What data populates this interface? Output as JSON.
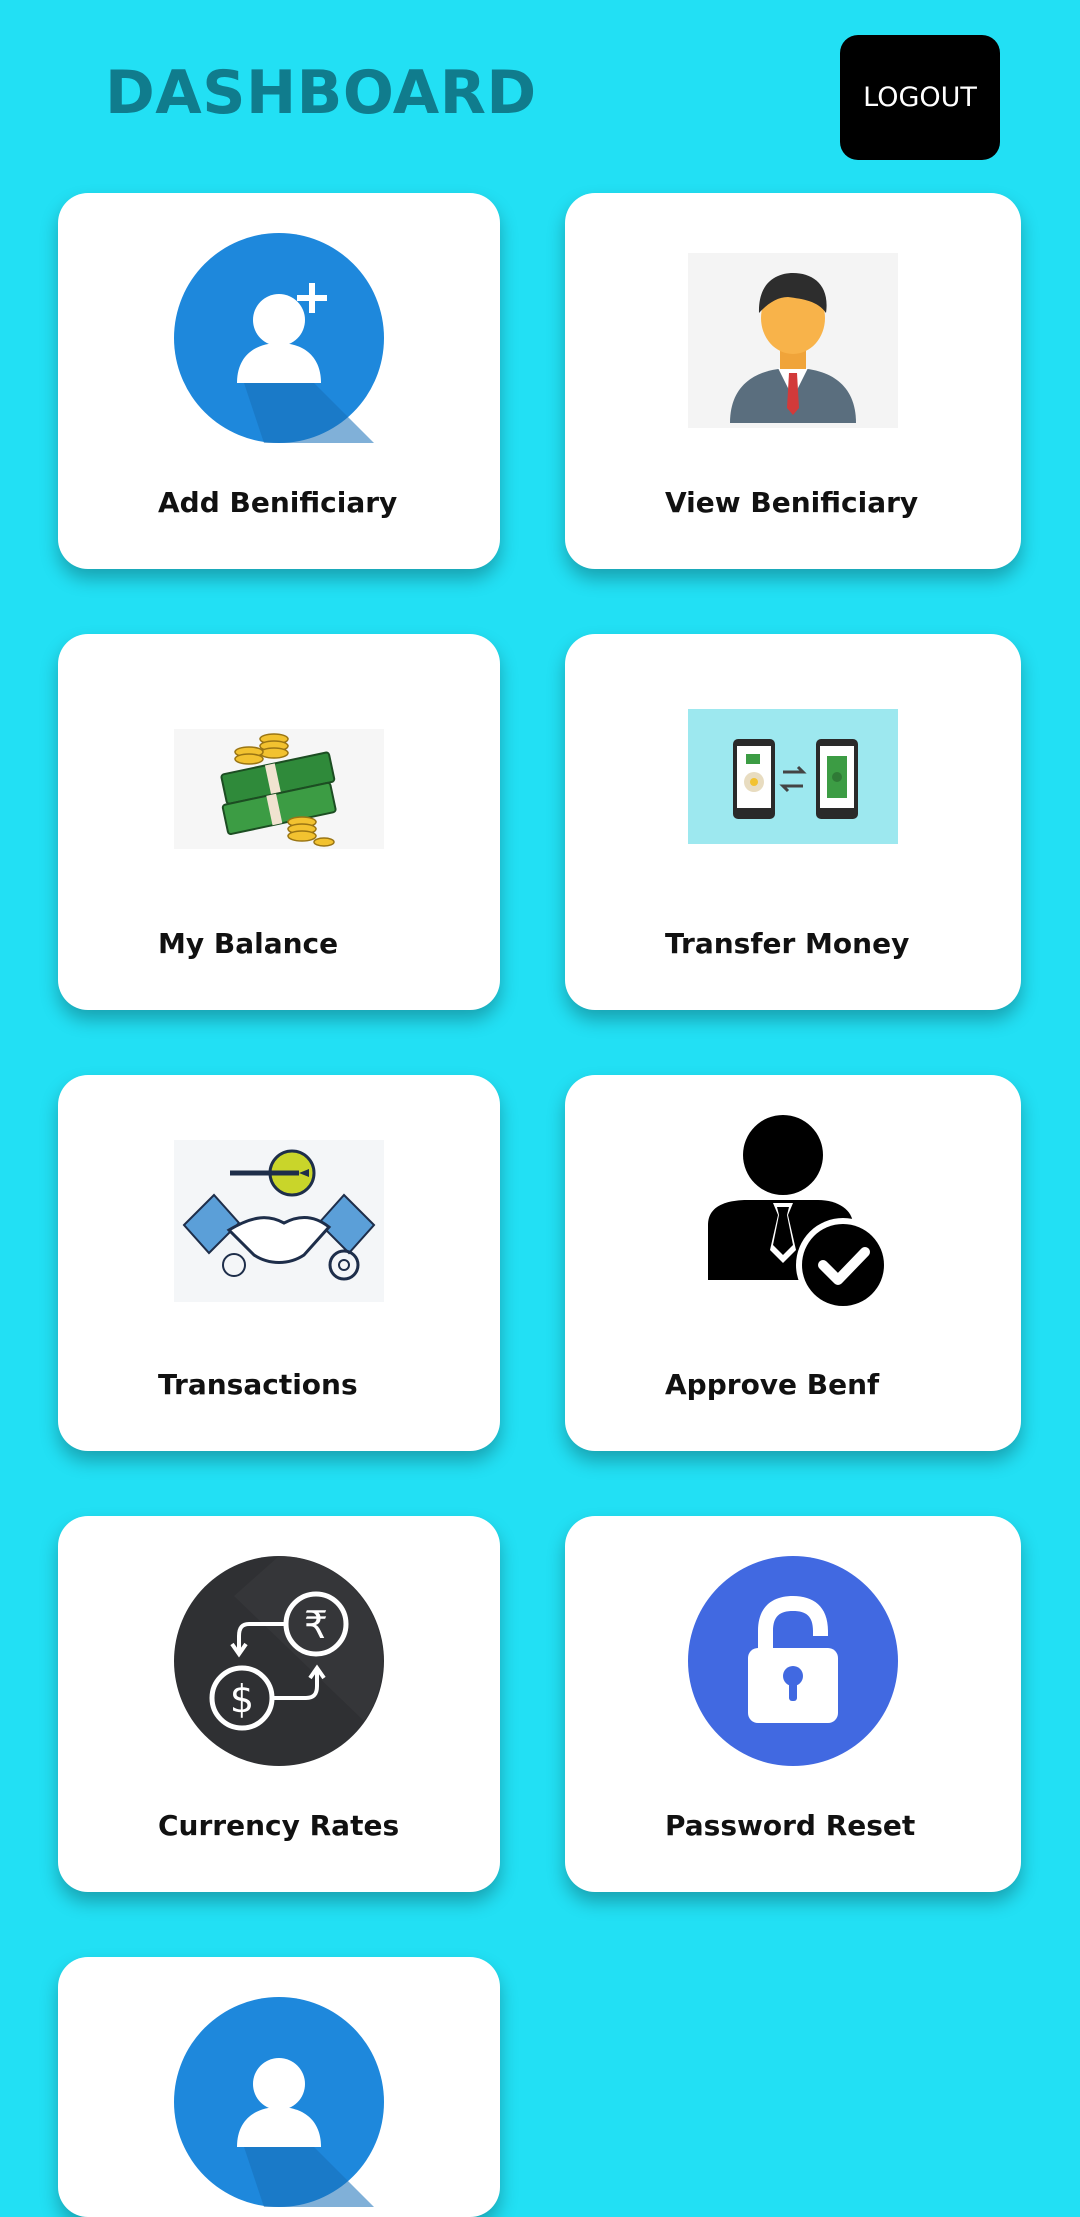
{
  "header": {
    "title": "DASHBOARD",
    "logout_label": "LOGOUT"
  },
  "colors": {
    "background": "#22e0f4",
    "title": "#107c8d",
    "card": "#ffffff",
    "logout_bg": "#000000"
  },
  "cards": [
    {
      "label": "Add Benificiary",
      "icon": "add-user-icon"
    },
    {
      "label": "View Benificiary",
      "icon": "businessman-icon"
    },
    {
      "label": "My Balance",
      "icon": "money-stack-icon"
    },
    {
      "label": "Transfer Money",
      "icon": "phone-transfer-icon"
    },
    {
      "label": "Transactions",
      "icon": "handshake-icon"
    },
    {
      "label": "Approve Benf",
      "icon": "user-approved-icon"
    },
    {
      "label": "Currency Rates",
      "icon": "currency-exchange-icon"
    },
    {
      "label": "Password Reset",
      "icon": "lock-icon"
    },
    {
      "label": "",
      "icon": "user-icon"
    }
  ]
}
